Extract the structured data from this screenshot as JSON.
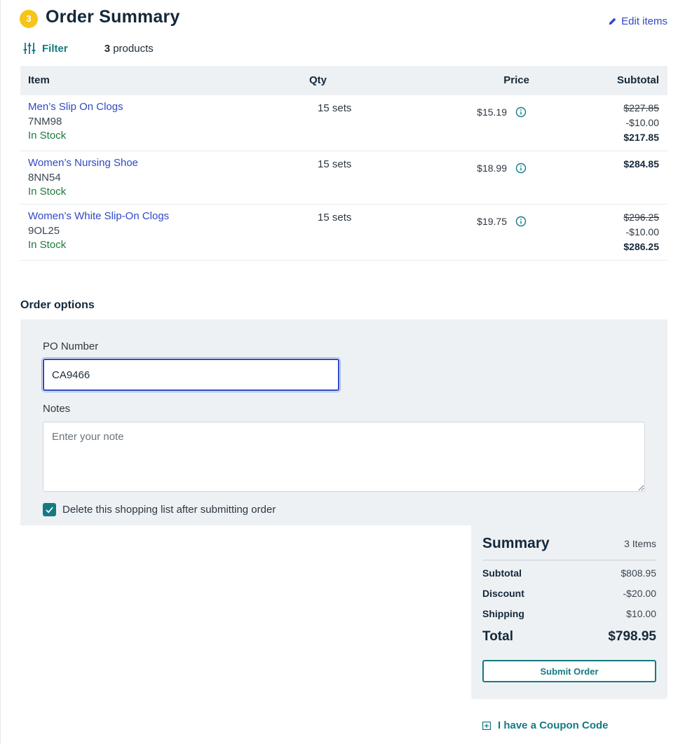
{
  "header": {
    "step_number": "3",
    "title": "Order Summary",
    "edit_label": "Edit items"
  },
  "toolbar": {
    "filter_label": "Filter",
    "product_count": "3",
    "product_count_suffix": "products"
  },
  "table": {
    "columns": [
      "Item",
      "Qty",
      "Price",
      "Subtotal"
    ],
    "rows": [
      {
        "name": "Men’s Slip On Clogs",
        "sku": "7NM98",
        "stock": "In Stock",
        "qty": "15 sets",
        "price": "$15.19",
        "original_subtotal": "$227.85",
        "discount": "-$10.00",
        "subtotal": "$217.85"
      },
      {
        "name": "Women’s Nursing Shoe",
        "sku": "8NN54",
        "stock": "In Stock",
        "qty": "15 sets",
        "price": "$18.99",
        "subtotal": "$284.85"
      },
      {
        "name": "Women’s White Slip-On Clogs",
        "sku": "9OL25",
        "stock": "In Stock",
        "qty": "15 sets",
        "price": "$19.75",
        "original_subtotal": "$296.25",
        "discount": "-$10.00",
        "subtotal": "$286.25"
      }
    ]
  },
  "order_options": {
    "title": "Order options",
    "po_label": "PO Number",
    "po_value": "CA9466",
    "notes_label": "Notes",
    "notes_placeholder": "Enter your note",
    "delete_list_label": "Delete this shopping list after submitting order",
    "delete_list_checked": true
  },
  "summary": {
    "title": "Summary",
    "items_count": "3 Items",
    "subtotal_label": "Subtotal",
    "subtotal_value": "$808.95",
    "discount_label": "Discount",
    "discount_value": "-$20.00",
    "shipping_label": "Shipping",
    "shipping_value": "$10.00",
    "total_label": "Total",
    "total_value": "$798.95",
    "submit_label": "Submit Order"
  },
  "coupon": {
    "label": "I have a Coupon Code"
  },
  "colors": {
    "link_blue": "#2f49c4",
    "teal_accent": "#147a82",
    "badge_yellow": "#f5c518",
    "in_stock_green": "#1f7a3b",
    "panel_gray": "#eef1f4"
  }
}
